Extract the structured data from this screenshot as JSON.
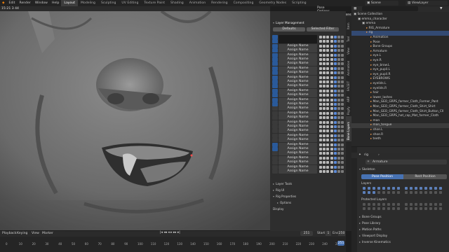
{
  "topbar": {
    "version": "15:21 3 44",
    "menus": [
      "Edit",
      "Render",
      "Window",
      "Help"
    ],
    "workspaces": [
      "Layout",
      "Modeling",
      "Sculpting",
      "UV Editing",
      "Texture Paint",
      "Shading",
      "Animation",
      "Rendering",
      "Compositing",
      "Geometry Nodes",
      "Scripting"
    ],
    "active_workspace": "Layout",
    "scene": "Scene",
    "view_layer": "ViewLayer"
  },
  "viewport": {
    "mode": "Pose Options"
  },
  "sidebar_tabs": [
    "Item",
    "Tool",
    "View",
    "Animation",
    "FACEIT",
    "ARP",
    "Rigify",
    "Bone Layers"
  ],
  "active_sidebar_tab": "Bone Layers",
  "layer_management": {
    "title": "Layer Management",
    "defaults_button": "Defaults",
    "filter_button": "Selected Filter",
    "row_label": "Assign Name",
    "rows_on": [
      true,
      true,
      true,
      true,
      true,
      true,
      true,
      true,
      true,
      true,
      true,
      true,
      true,
      true,
      true,
      true,
      false,
      false,
      false,
      false,
      false,
      false,
      false,
      false,
      true,
      true,
      false,
      false,
      false,
      false,
      false
    ],
    "layer_tools": "Layer Tools",
    "rig_ui": "Rig UI",
    "rig_properties": "Rig Properties",
    "options": "Options",
    "display": "Display"
  },
  "outliner": {
    "header": "Scene Collection",
    "rows": [
      {
        "text": "Scene Collection",
        "indent": 0,
        "sel": false
      },
      {
        "text": "emma_character",
        "indent": 1,
        "sel": false
      },
      {
        "text": "emma",
        "indent": 2,
        "sel": false
      },
      {
        "text": "RIG_Armature",
        "indent": 3,
        "sel": false
      },
      {
        "text": "rig",
        "indent": 3,
        "sel": true
      },
      {
        "text": "Animation",
        "indent": 4,
        "sel": false
      },
      {
        "text": "Pose",
        "indent": 4,
        "sel": false
      },
      {
        "text": "Bone Groups",
        "indent": 4,
        "sel": false
      },
      {
        "text": "Armature",
        "indent": 4,
        "sel": false
      },
      {
        "text": "eye.L",
        "indent": 4,
        "sel": false
      },
      {
        "text": "eye.R",
        "indent": 4,
        "sel": false
      },
      {
        "text": "eye_brow.L",
        "indent": 4,
        "sel": false
      },
      {
        "text": "eye_pupil.L",
        "indent": 4,
        "sel": false
      },
      {
        "text": "eye_pupil.R",
        "indent": 4,
        "sel": false
      },
      {
        "text": "EYEBROWS",
        "indent": 4,
        "sel": false
      },
      {
        "text": "eyelids.L",
        "indent": 4,
        "sel": false
      },
      {
        "text": "eyelids.R",
        "indent": 4,
        "sel": false
      },
      {
        "text": "hair",
        "indent": 4,
        "sel": false
      },
      {
        "text": "lower_lashes",
        "indent": 4,
        "sel": false
      },
      {
        "text": "Man_GEO_GRPS_farmer_Cloth_Farmer_Pant",
        "indent": 4,
        "sel": false
      },
      {
        "text": "Man_GEO_GRPS_farmer_Cloth_Shirt_Shirt",
        "indent": 4,
        "sel": false
      },
      {
        "text": "Man_GEO_GRPS_farmer_Cloth_Shirt_Button_Cll",
        "indent": 4,
        "sel": false
      },
      {
        "text": "Man_GEO_GRPS_hat_cap_Mat_farmer_Cloth",
        "indent": 4,
        "sel": false
      },
      {
        "text": "man",
        "indent": 4,
        "sel": false
      },
      {
        "text": "man_tongue",
        "indent": 4,
        "hl": true
      },
      {
        "text": "shoe.L",
        "indent": 4,
        "sel": false
      },
      {
        "text": "shoe.R",
        "indent": 4,
        "sel": false
      },
      {
        "text": "teeth",
        "indent": 4,
        "sel": false
      }
    ]
  },
  "properties": {
    "object": "rig",
    "data": "Armature",
    "skeleton_header": "Skeleton",
    "pose_position": "Pose Position",
    "rest_position": "Rest Position",
    "layers_label": "Layers",
    "protected_layers_label": "Protected Layers",
    "panels": [
      "Bone Groups",
      "Pose Library",
      "Motion Paths",
      "Viewport Display",
      "Inverse Kinematics"
    ]
  },
  "timeline": {
    "menus": [
      "Playback",
      "Keying",
      "View",
      "Marker"
    ],
    "frame_current": "251",
    "start_label": "Start",
    "start": "1",
    "end_label": "End",
    "end": "250",
    "ticks": [
      "0",
      "10",
      "20",
      "30",
      "40",
      "50",
      "60",
      "70",
      "80",
      "90",
      "100",
      "110",
      "120",
      "130",
      "140",
      "150",
      "160",
      "170",
      "180",
      "190",
      "200",
      "210",
      "220",
      "230",
      "240",
      "250"
    ]
  },
  "colors": {
    "accent": "#4772b3",
    "selection": "#334a73",
    "timeline_playhead": "#4772b3"
  }
}
